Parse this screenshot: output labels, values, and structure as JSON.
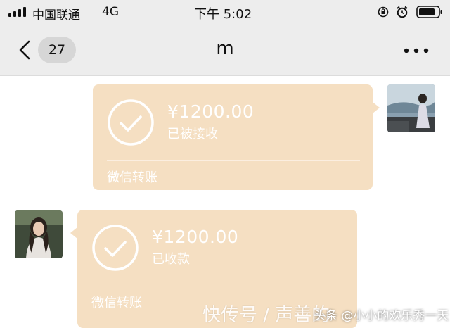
{
  "status_bar": {
    "carrier": "中国联通",
    "network": "4G",
    "time": "下午 5:02"
  },
  "header": {
    "unread_count": "27",
    "title": "m"
  },
  "messages": [
    {
      "side": "right",
      "amount": "¥1200.00",
      "status": "已被接收",
      "footer": "微信转账"
    },
    {
      "side": "left",
      "amount": "¥1200.00",
      "status": "已收款",
      "footer": "微信转账"
    }
  ],
  "watermarks": {
    "large": "快传号 / 声善的",
    "small": "头条 @小小的欢乐秀一天"
  },
  "colors": {
    "transfer_bubble": "#f5dfc2",
    "header_bg": "#ededed"
  }
}
